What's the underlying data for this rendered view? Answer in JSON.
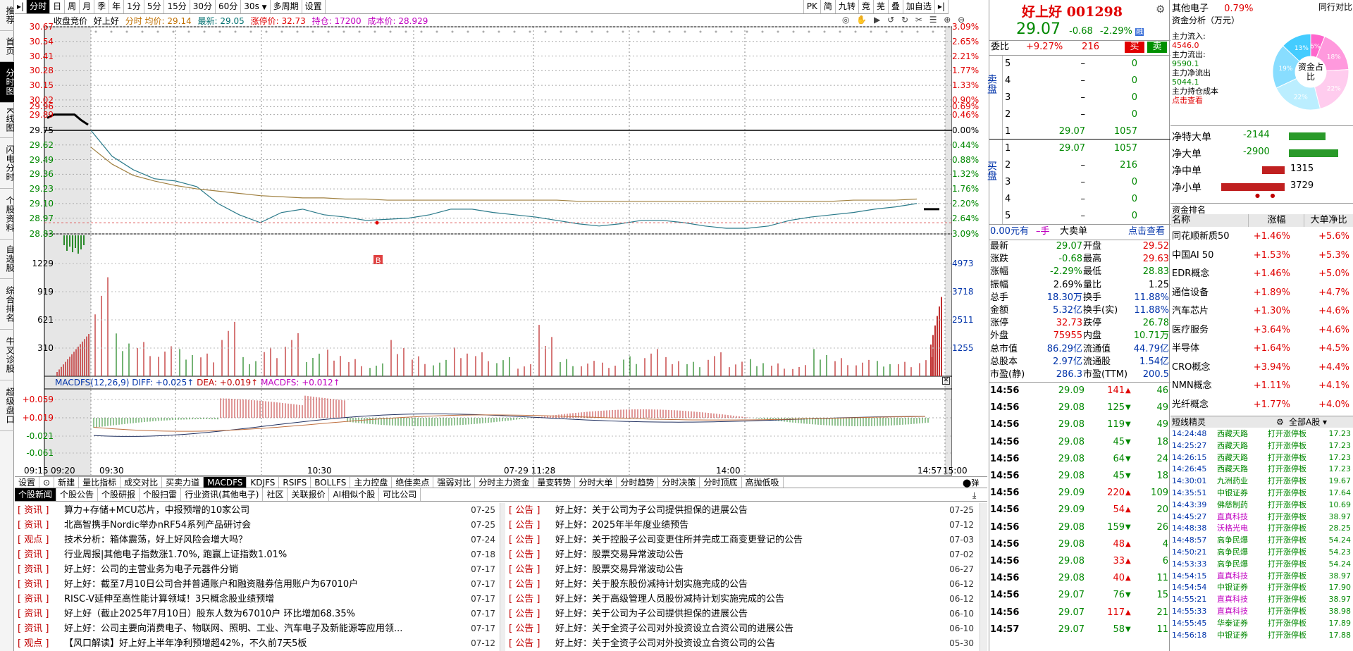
{
  "left_nav": [
    "推荐",
    "首页",
    "分时图",
    "K线图",
    "闪电分时",
    "个股资料",
    "自选股",
    "综合排名",
    "牛叉诊股",
    "超级盘口"
  ],
  "left_nav_active": 2,
  "toolbar": {
    "items": [
      "分时",
      "日",
      "周",
      "月",
      "季",
      "年",
      "1分",
      "5分",
      "15分",
      "30分",
      "60分",
      "30s",
      "▼",
      "多周期",
      "设置"
    ],
    "right_items": [
      "PK",
      "简",
      "九转",
      "竞",
      "芜",
      "叠",
      "加自选"
    ]
  },
  "chart_header": {
    "items": [
      {
        "text": "收盘竞价",
        "color": "#000000"
      },
      {
        "text": "好上好",
        "color": "#000000"
      },
      {
        "text": "分时 均价: 29.14",
        "color": "#c07000"
      },
      {
        "text": "最新: 29.05",
        "color": "#007070"
      },
      {
        "text": "涨停价: 32.73",
        "color": "#e00000"
      },
      {
        "text": "持仓: 17200",
        "color": "#c000c0"
      },
      {
        "text": "成本价: 28.929",
        "color": "#c000c0"
      }
    ]
  },
  "price_axis": {
    "left": [
      "30.67",
      "30.54",
      "30.41",
      "30.28",
      "30.15",
      "30.02",
      "29.96",
      "29.89",
      "29.75",
      "29.62",
      "29.49",
      "29.36",
      "29.23",
      "29.10",
      "28.97",
      "28.83"
    ],
    "right": [
      "3.09%",
      "2.65%",
      "2.21%",
      "1.77%",
      "1.33%",
      "0.90%",
      "0.69%",
      "0.46%",
      "0.00%",
      "0.44%",
      "0.88%",
      "1.32%",
      "1.76%",
      "2.20%",
      "2.64%",
      "3.09%"
    ]
  },
  "volume_axis": {
    "left": [
      "1229",
      "919",
      "621",
      "310"
    ],
    "right": [
      "4973",
      "3718",
      "2511",
      "1255"
    ]
  },
  "macd": {
    "header": [
      {
        "text": "MACDFS(12,26,9)",
        "color": "#0033aa"
      },
      {
        "text": "DIFF: +0.025↑",
        "color": "#0033aa"
      },
      {
        "text": "DEA: +0.019↑",
        "color": "#c00000"
      },
      {
        "text": "MACDFS: +0.012↑",
        "color": "#c000c0"
      }
    ],
    "axis": [
      "+0.059",
      "+0.019",
      "-0.021",
      "-0.061"
    ]
  },
  "time_axis": [
    "09:15",
    "09:20",
    "09:30",
    "10:30",
    "07-29 11:28",
    "14:00",
    "14:57",
    "15:00"
  ],
  "trade_marker": "B",
  "chart_data": {
    "type": "line",
    "x_labels": [
      "09:30",
      "10:30",
      "11:28",
      "14:00",
      "14:57"
    ],
    "ylim": [
      28.83,
      30.67
    ],
    "prev_close": 29.75,
    "series": [
      {
        "name": "分时",
        "values": [
          29.75,
          29.52,
          29.4,
          29.32,
          29.3,
          29.25,
          29.1,
          29.0,
          28.93,
          29.02,
          29.05,
          29.0,
          28.98,
          28.95,
          28.96,
          28.97,
          29.0,
          29.05,
          29.05,
          29.02,
          29.0,
          28.98,
          28.95,
          28.92,
          28.9,
          28.92,
          28.95,
          28.95,
          28.93,
          28.9,
          28.88,
          28.88,
          28.9,
          28.95,
          28.98,
          29.0,
          29.02,
          29.05,
          29.07,
          29.1
        ]
      },
      {
        "name": "均价",
        "values": [
          29.6,
          29.45,
          29.35,
          29.3,
          29.26,
          29.23,
          29.21,
          29.19,
          29.17,
          29.16,
          29.15,
          29.15,
          29.14,
          29.14,
          29.13,
          29.13,
          29.13,
          29.13,
          29.13,
          29.13,
          29.13,
          29.13,
          29.13,
          29.12,
          29.12,
          29.12,
          29.12,
          29.12,
          29.12,
          29.12,
          29.12,
          29.12,
          29.12,
          29.12,
          29.12,
          29.12,
          29.13,
          29.13,
          29.13,
          29.14
        ]
      }
    ],
    "pre_market": [
      29.86,
      29.89,
      29.89,
      29.89,
      29.89,
      29.84,
      29.8
    ],
    "volume": [
      1229,
      500,
      400,
      350,
      300,
      250,
      600,
      200,
      300,
      450,
      280,
      310,
      200,
      150,
      400,
      220,
      180,
      300,
      250,
      200,
      150,
      600,
      200,
      180,
      150,
      220,
      300,
      200,
      150,
      250,
      180,
      200,
      150,
      130,
      300,
      200,
      180,
      160,
      150,
      200
    ]
  },
  "quote": {
    "name": "好上好",
    "code": "001298",
    "price": "29.07",
    "change": "-0.68",
    "change_pct": "-2.29%",
    "rong": "融",
    "weibi_label": "委比",
    "weibi": "+9.27%",
    "weicha": "216",
    "buy_btn": "买",
    "sell_btn": "卖",
    "sell_label": "卖盘",
    "buy_label": "买盘",
    "asks": [
      {
        "lvl": "5",
        "price": "–",
        "vol": "0"
      },
      {
        "lvl": "4",
        "price": "–",
        "vol": "0"
      },
      {
        "lvl": "3",
        "price": "–",
        "vol": "0"
      },
      {
        "lvl": "2",
        "price": "–",
        "vol": "0"
      },
      {
        "lvl": "1",
        "price": "29.07",
        "vol": "1057"
      }
    ],
    "bids": [
      {
        "lvl": "1",
        "price": "29.07",
        "vol": "1057"
      },
      {
        "lvl": "2",
        "price": "–",
        "vol": "216"
      },
      {
        "lvl": "3",
        "price": "–",
        "vol": "0"
      },
      {
        "lvl": "4",
        "price": "–",
        "vol": "0"
      },
      {
        "lvl": "5",
        "price": "–",
        "vol": "0"
      }
    ],
    "big_order": {
      "amount": "0.00元有",
      "hands": "–手",
      "label": "大卖单",
      "link": "点击查看"
    },
    "stats": [
      [
        "最新",
        "29.07",
        "开盘",
        "29.52"
      ],
      [
        "涨跌",
        "-0.68",
        "最高",
        "29.63"
      ],
      [
        "涨幅",
        "-2.29%",
        "最低",
        "28.83"
      ],
      [
        "振幅",
        "2.69%",
        "量比",
        "1.25"
      ],
      [
        "总手",
        "18.30万",
        "换手",
        "11.88%"
      ],
      [
        "金额",
        "5.32亿",
        "换手(实)",
        "11.88%"
      ],
      [
        "涨停",
        "32.73",
        "跌停",
        "26.78"
      ],
      [
        "外盘",
        "75955",
        "内盘",
        "10.71万"
      ],
      [
        "总市值",
        "86.29亿",
        "流通值",
        "44.79亿"
      ],
      [
        "总股本",
        "2.97亿",
        "流通股",
        "1.54亿"
      ],
      [
        "市盈(静)",
        "286.3",
        "市盈(TTM)",
        "200.5"
      ]
    ],
    "ticks": [
      {
        "time": "14:56",
        "price": "29.09",
        "vol": "141",
        "dir": "up",
        "num": "46"
      },
      {
        "time": "14:56",
        "price": "29.08",
        "vol": "125",
        "dir": "down",
        "num": "49"
      },
      {
        "time": "14:56",
        "price": "29.08",
        "vol": "119",
        "dir": "down",
        "num": "49"
      },
      {
        "time": "14:56",
        "price": "29.08",
        "vol": "45",
        "dir": "down",
        "num": "18"
      },
      {
        "time": "14:56",
        "price": "29.08",
        "vol": "64",
        "dir": "down",
        "num": "24"
      },
      {
        "time": "14:56",
        "price": "29.08",
        "vol": "45",
        "dir": "down",
        "num": "18"
      },
      {
        "time": "14:56",
        "price": "29.09",
        "vol": "220",
        "dir": "up",
        "num": "109"
      },
      {
        "time": "14:56",
        "price": "29.09",
        "vol": "54",
        "dir": "up",
        "num": "20"
      },
      {
        "time": "14:56",
        "price": "29.08",
        "vol": "159",
        "dir": "down",
        "num": "26"
      },
      {
        "time": "14:56",
        "price": "29.08",
        "vol": "48",
        "dir": "up",
        "num": "4"
      },
      {
        "time": "14:56",
        "price": "29.08",
        "vol": "33",
        "dir": "up",
        "num": "6"
      },
      {
        "time": "14:56",
        "price": "29.08",
        "vol": "40",
        "dir": "up",
        "num": "11"
      },
      {
        "time": "14:56",
        "price": "29.07",
        "vol": "76",
        "dir": "down",
        "num": "15"
      },
      {
        "time": "14:56",
        "price": "29.07",
        "vol": "117",
        "dir": "up",
        "num": "21"
      },
      {
        "time": "14:57",
        "price": "29.07",
        "vol": "58",
        "dir": "down",
        "num": "11"
      }
    ]
  },
  "fund": {
    "sector": "其他电子",
    "sector_pct": "0.79%",
    "peer_compare": "同行对比",
    "title": "资金分析（万元）",
    "inflow_label": "主力流入:",
    "inflow": "4546.0",
    "outflow_label": "主力流出:",
    "outflow": "9590.1",
    "net_label": "主力净流出",
    "net": "5044.1",
    "cost_label": "主力持仓成本",
    "cost_link": "点击查看",
    "pie_center": "资金占比",
    "pie_data": [
      {
        "label": "6%",
        "value": 6,
        "color": "#ff66cc"
      },
      {
        "label": "18%",
        "value": 18,
        "color": "#ff99dd"
      },
      {
        "label": "22%",
        "value": 22,
        "color": "#ffccee"
      },
      {
        "label": "22%",
        "value": 22,
        "color": "#bbeeff"
      },
      {
        "label": "19%",
        "value": 19,
        "color": "#88ddff"
      },
      {
        "label": "13%",
        "value": 13,
        "color": "#44ccff"
      }
    ],
    "net_bars": [
      {
        "label": "净特大单",
        "value": "-2144",
        "num": -2144
      },
      {
        "label": "净大单",
        "value": "-2900",
        "num": -2900
      },
      {
        "label": "净中单",
        "value": "1315",
        "num": 1315
      },
      {
        "label": "净小单",
        "value": "3729",
        "num": 3729
      }
    ],
    "rank_title": "资金排名",
    "rank_headers": [
      "名称",
      "涨幅",
      "大单净比"
    ],
    "rank_rows": [
      [
        "同花顺新质50",
        "+1.46%",
        "+5.6%"
      ],
      [
        "中国AI 50",
        "+1.53%",
        "+5.3%"
      ],
      [
        "EDR概念",
        "+1.46%",
        "+5.0%"
      ],
      [
        "通信设备",
        "+1.89%",
        "+4.7%"
      ],
      [
        "汽车芯片",
        "+1.30%",
        "+4.6%"
      ],
      [
        "医疗服务",
        "+3.64%",
        "+4.6%"
      ],
      [
        "半导体",
        "+1.64%",
        "+4.5%"
      ],
      [
        "CRO概念",
        "+3.94%",
        "+4.4%"
      ],
      [
        "NMN概念",
        "+1.11%",
        "+4.1%"
      ],
      [
        "光纤概念",
        "+1.77%",
        "+4.0%"
      ]
    ],
    "short_title": "短线精灵",
    "short_filter": "全部A股",
    "short_rows": [
      [
        "14:24:48",
        "西藏天路",
        "打开涨停板",
        "17.23"
      ],
      [
        "14:25:27",
        "西藏天路",
        "打开涨停板",
        "17.23"
      ],
      [
        "14:26:15",
        "西藏天路",
        "打开涨停板",
        "17.23"
      ],
      [
        "14:26:45",
        "西藏天路",
        "打开涨停板",
        "17.23"
      ],
      [
        "14:30:01",
        "九洲药业",
        "打开涨停板",
        "19.67"
      ],
      [
        "14:35:51",
        "中银证券",
        "打开涨停板",
        "17.64"
      ],
      [
        "14:43:39",
        "佛慈制药",
        "打开涨停板",
        "10.69"
      ],
      [
        "14:45:27",
        "直真科技",
        "打开涨停板",
        "38.97"
      ],
      [
        "14:48:38",
        "沃格光电",
        "打开涨停板",
        "28.25"
      ],
      [
        "14:48:57",
        "高争民爆",
        "打开涨停板",
        "54.24"
      ],
      [
        "14:50:21",
        "高争民爆",
        "打开涨停板",
        "54.23"
      ],
      [
        "14:53:33",
        "高争民爆",
        "打开涨停板",
        "54.24"
      ],
      [
        "14:54:15",
        "直真科技",
        "打开涨停板",
        "38.97"
      ],
      [
        "14:54:54",
        "中银证券",
        "打开涨停板",
        "17.90"
      ],
      [
        "14:55:21",
        "直真科技",
        "打开涨停板",
        "38.97"
      ],
      [
        "14:55:33",
        "直真科技",
        "打开涨停板",
        "38.98"
      ],
      [
        "14:55:45",
        "华泰证券",
        "打开涨停板",
        "17.89"
      ],
      [
        "14:56:18",
        "中银证券",
        "打开涨停板",
        "17.88"
      ]
    ]
  },
  "indicator_tabs": [
    "设置",
    "⊙",
    "新建",
    "量比指标",
    "成交对比",
    "买卖力道",
    "MACDFS",
    "KDJFS",
    "RSIFS",
    "BOLLFS",
    "主力控盘",
    "绝佳卖点",
    "强弱对比",
    "分时主力资金",
    "量变转势",
    "分时大单",
    "分时趋势",
    "分时决策",
    "分时顶底",
    "高抛低吸"
  ],
  "indicator_active": 6,
  "news_tabs": [
    "个股新闻",
    "个股公告",
    "个股研报",
    "个股扫雷",
    "行业资讯(其他电子)",
    "社区",
    "关联报价",
    "AI相似个股",
    "可比公司"
  ],
  "news_active": 0,
  "news_left": [
    {
      "cat": "[ 资讯 ]",
      "title": "算力+存储+MCU芯片，中报预增的10家公司",
      "date": "07-25"
    },
    {
      "cat": "[ 资讯 ]",
      "title": "北高智携手Nordic举办nRF54系列产品研讨会",
      "date": "07-25"
    },
    {
      "cat": "[ 观点 ]",
      "title": "技术分析：箱体震荡，好上好风险会增大吗？",
      "date": "07-24"
    },
    {
      "cat": "[ 资讯 ]",
      "title": "行业周报|其他电子指数涨1.70%, 跑赢上证指数1.01%",
      "date": "07-18"
    },
    {
      "cat": "[ 资讯 ]",
      "title": "好上好：公司的主营业务为电子元器件分销",
      "date": "07-17"
    },
    {
      "cat": "[ 资讯 ]",
      "title": "好上好：截至7月10日公司合并普通账户和融资融券信用账户为67010户",
      "date": "07-17"
    },
    {
      "cat": "[ 资讯 ]",
      "title": "RISC-V延伸至高性能计算领域！3只概念股业绩预增",
      "date": "07-17"
    },
    {
      "cat": "[ 资讯 ]",
      "title": "好上好（截止2025年7月10日）股东人数为67010户 环比增加68.35%",
      "date": "07-17"
    },
    {
      "cat": "[ 资讯 ]",
      "title": "好上好：公司主要向消费电子、物联网、照明、工业、汽车电子及新能源等应用领...",
      "date": "07-17"
    },
    {
      "cat": "[ 观点 ]",
      "title": "【风口解读】好上好上半年净利预增超42%，不久前7天5板",
      "date": "07-12"
    }
  ],
  "news_right": [
    {
      "cat": "[ 公告 ]",
      "title": "好上好：关于公司为子公司提供担保的进展公告",
      "date": "07-25"
    },
    {
      "cat": "[ 公告 ]",
      "title": "好上好：2025年半年度业绩预告",
      "date": "07-12"
    },
    {
      "cat": "[ 公告 ]",
      "title": "好上好：关于控股子公司变更住所并完成工商变更登记的公告",
      "date": "07-03"
    },
    {
      "cat": "[ 公告 ]",
      "title": "好上好：股票交易异常波动公告",
      "date": "07-02"
    },
    {
      "cat": "[ 公告 ]",
      "title": "好上好：股票交易异常波动公告",
      "date": "06-27"
    },
    {
      "cat": "[ 公告 ]",
      "title": "好上好：关于股东股份减持计划实施完成的公告",
      "date": "06-12"
    },
    {
      "cat": "[ 公告 ]",
      "title": "好上好：关于高级管理人员股份减持计划实施完成的公告",
      "date": "06-12"
    },
    {
      "cat": "[ 公告 ]",
      "title": "好上好：关于公司为子公司提供担保的进展公告",
      "date": "06-10"
    },
    {
      "cat": "[ 公告 ]",
      "title": "好上好：关于全资子公司对外投资设立合资公司的进展公告",
      "date": "06-10"
    },
    {
      "cat": "[ 公告 ]",
      "title": "好上好：关于全资子公司对外投资设立合资公司的公告",
      "date": "05-30"
    }
  ],
  "colors": {
    "up": "#e00000",
    "down": "#008800",
    "price_line": "#2a7a8a",
    "avg_line": "#a08040"
  }
}
